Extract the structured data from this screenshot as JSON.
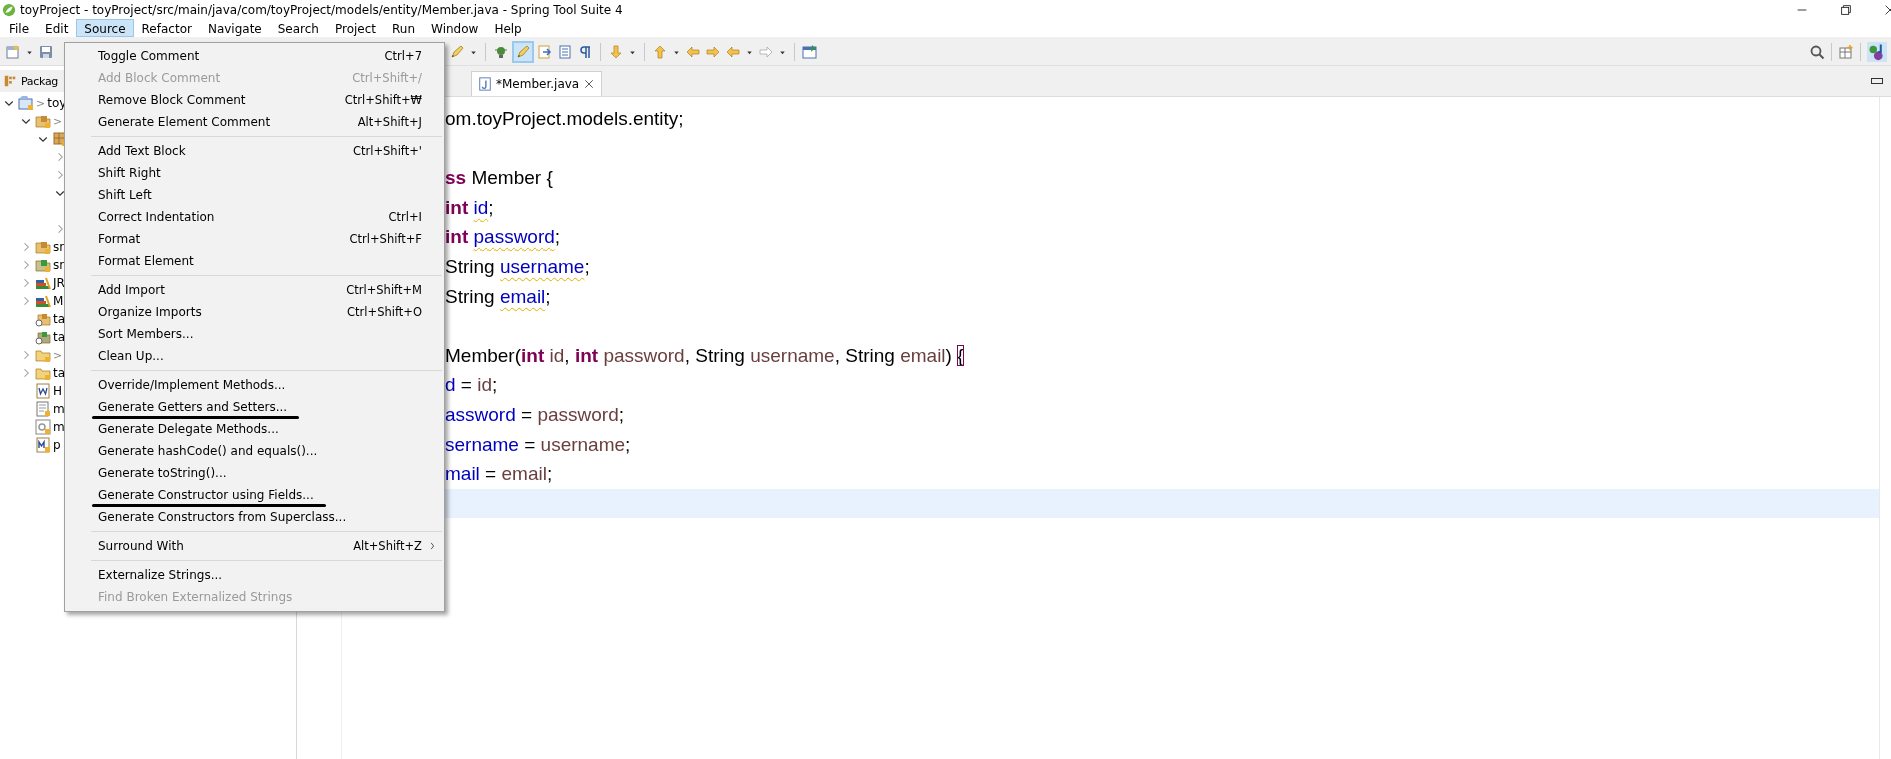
{
  "window": {
    "title": "toyProject - toyProject/src/main/java/com/toyProject/models/entity/Member.java - Spring Tool Suite 4"
  },
  "menubar": [
    {
      "label": "File",
      "selected": false
    },
    {
      "label": "Edit",
      "selected": false
    },
    {
      "label": "Source",
      "selected": true
    },
    {
      "label": "Refactor",
      "selected": false
    },
    {
      "label": "Navigate",
      "selected": false
    },
    {
      "label": "Search",
      "selected": false
    },
    {
      "label": "Project",
      "selected": false
    },
    {
      "label": "Run",
      "selected": false
    },
    {
      "label": "Window",
      "selected": false
    },
    {
      "label": "Help",
      "selected": false
    }
  ],
  "sidebar": {
    "title": "Packag",
    "tree": [
      {
        "kind": "project",
        "decorator": ">",
        "label": "toy",
        "expanded": true,
        "children": [
          {
            "kind": "source-folder",
            "decorator": ">",
            "expanded": true,
            "children": [
              {
                "kind": "package",
                "expanded": true,
                "children": [
                  {
                    "expanded": false
                  },
                  {
                    "expanded": false
                  },
                  {
                    "expanded": true
                  },
                  {
                    "expanded": false
                  }
                ]
              }
            ]
          },
          {
            "kind": "source-folder",
            "label": "sr",
            "expanded": false
          },
          {
            "kind": "source-folder-green",
            "label": "sr",
            "expanded": false
          },
          {
            "kind": "library",
            "label": "JR",
            "expanded": false
          },
          {
            "kind": "library",
            "label": "M",
            "expanded": false
          },
          {
            "kind": "source-folder-off",
            "label": "ta"
          },
          {
            "kind": "source-folder-off-green",
            "label": "ta"
          },
          {
            "kind": "folder",
            "decorator": ">",
            "expanded": false
          },
          {
            "kind": "folder",
            "label": "ta",
            "expanded": false
          },
          {
            "kind": "word-file",
            "label": "H"
          },
          {
            "kind": "text-file",
            "label": "m"
          },
          {
            "kind": "settings-file",
            "label": "m"
          },
          {
            "kind": "maven-file",
            "label": "p"
          }
        ]
      }
    ]
  },
  "editor": {
    "tab": {
      "label": "*Member.java",
      "selected": true
    },
    "lines": [
      {
        "current": false,
        "tokens": [
          {
            "text": "om.toyProject.models.entity;",
            "kind": "plain"
          }
        ]
      },
      {
        "current": false
      },
      {
        "current": false,
        "tokens": [
          {
            "text": "ss",
            "kind": "keyword"
          },
          {
            "text": " Member {",
            "kind": "plain"
          }
        ]
      },
      {
        "current": false,
        "tokens": [
          {
            "text": "int ",
            "kind": "keyword"
          },
          {
            "text": "id",
            "kind": "field",
            "warning": true
          },
          {
            "text": ";",
            "kind": "plain"
          }
        ]
      },
      {
        "current": false,
        "tokens": [
          {
            "text": "int ",
            "kind": "keyword"
          },
          {
            "text": "password",
            "kind": "field",
            "warning": true
          },
          {
            "text": ";",
            "kind": "plain"
          }
        ]
      },
      {
        "current": false,
        "tokens": [
          {
            "text": "String ",
            "kind": "plain"
          },
          {
            "text": "username",
            "kind": "field",
            "warning": true
          },
          {
            "text": ";",
            "kind": "plain"
          }
        ]
      },
      {
        "current": false,
        "tokens": [
          {
            "text": "String ",
            "kind": "plain"
          },
          {
            "text": "email",
            "kind": "field",
            "warning": true
          },
          {
            "text": ";",
            "kind": "plain"
          }
        ]
      },
      {
        "current": false
      },
      {
        "current": false,
        "tokens": [
          {
            "text": "Member(",
            "kind": "plain"
          },
          {
            "text": "int ",
            "kind": "keyword"
          },
          {
            "text": "id",
            "kind": "param"
          },
          {
            "text": ", ",
            "kind": "plain"
          },
          {
            "text": "int ",
            "kind": "keyword"
          },
          {
            "text": "password",
            "kind": "param"
          },
          {
            "text": ", String ",
            "kind": "plain"
          },
          {
            "text": "username",
            "kind": "param"
          },
          {
            "text": ", String ",
            "kind": "plain"
          },
          {
            "text": "email",
            "kind": "param"
          },
          {
            "text": ") ",
            "kind": "plain"
          },
          {
            "text": "{",
            "kind": "plain",
            "matched": true
          }
        ]
      },
      {
        "current": false,
        "tokens": [
          {
            "text": "d",
            "kind": "field"
          },
          {
            "text": " = ",
            "kind": "plain"
          },
          {
            "text": "id",
            "kind": "param"
          },
          {
            "text": ";",
            "kind": "plain"
          }
        ]
      },
      {
        "current": false,
        "tokens": [
          {
            "text": "assword",
            "kind": "field"
          },
          {
            "text": " = ",
            "kind": "plain"
          },
          {
            "text": "password",
            "kind": "param"
          },
          {
            "text": ";",
            "kind": "plain"
          }
        ]
      },
      {
        "current": false,
        "tokens": [
          {
            "text": "sername",
            "kind": "field"
          },
          {
            "text": " = ",
            "kind": "plain"
          },
          {
            "text": "username",
            "kind": "param"
          },
          {
            "text": ";",
            "kind": "plain"
          }
        ]
      },
      {
        "current": false,
        "tokens": [
          {
            "text": "mail",
            "kind": "field"
          },
          {
            "text": " = ",
            "kind": "plain"
          },
          {
            "text": "email",
            "kind": "param"
          },
          {
            "text": ";",
            "kind": "plain"
          }
        ]
      },
      {
        "current": true
      }
    ]
  },
  "menu": {
    "items": [
      {
        "kind": "item",
        "label": "Toggle Comment",
        "shortcut": "Ctrl+7",
        "disabled": false,
        "underlined": false
      },
      {
        "kind": "item",
        "label": "Add Block Comment",
        "shortcut": "Ctrl+Shift+/",
        "disabled": true,
        "underlined": false
      },
      {
        "kind": "item",
        "label": "Remove Block Comment",
        "shortcut": "Ctrl+Shift+₩",
        "disabled": false,
        "underlined": false
      },
      {
        "kind": "item",
        "label": "Generate Element Comment",
        "shortcut": "Alt+Shift+J",
        "disabled": false,
        "underlined": false
      },
      {
        "kind": "separator"
      },
      {
        "kind": "item",
        "label": "Add Text Block",
        "shortcut": "Ctrl+Shift+'",
        "disabled": false,
        "underlined": false
      },
      {
        "kind": "item",
        "label": "Shift Right",
        "disabled": false,
        "underlined": false
      },
      {
        "kind": "item",
        "label": "Shift Left",
        "disabled": false,
        "underlined": false
      },
      {
        "kind": "item",
        "label": "Correct Indentation",
        "shortcut": "Ctrl+I",
        "disabled": false,
        "underlined": false
      },
      {
        "kind": "item",
        "label": "Format",
        "shortcut": "Ctrl+Shift+F",
        "disabled": false,
        "underlined": false
      },
      {
        "kind": "item",
        "label": "Format Element",
        "disabled": false,
        "underlined": false
      },
      {
        "kind": "separator"
      },
      {
        "kind": "item",
        "label": "Add Import",
        "shortcut": "Ctrl+Shift+M",
        "disabled": false,
        "underlined": false
      },
      {
        "kind": "item",
        "label": "Organize Imports",
        "shortcut": "Ctrl+Shift+O",
        "disabled": false,
        "underlined": false
      },
      {
        "kind": "item",
        "label": "Sort Members...",
        "disabled": false,
        "underlined": false
      },
      {
        "kind": "item",
        "label": "Clean Up...",
        "disabled": false,
        "underlined": false
      },
      {
        "kind": "separator"
      },
      {
        "kind": "item",
        "label": "Override/Implement Methods...",
        "disabled": false,
        "underlined": false
      },
      {
        "kind": "item",
        "label": "Generate Getters and Setters...",
        "disabled": false,
        "underlined": true
      },
      {
        "kind": "item",
        "label": "Generate Delegate Methods...",
        "disabled": false,
        "underlined": false
      },
      {
        "kind": "item",
        "label": "Generate hashCode() and equals()...",
        "disabled": false,
        "underlined": false
      },
      {
        "kind": "item",
        "label": "Generate toString()...",
        "disabled": false,
        "underlined": false
      },
      {
        "kind": "item",
        "label": "Generate Constructor using Fields...",
        "disabled": false,
        "underlined": true
      },
      {
        "kind": "item",
        "label": "Generate Constructors from Superclass...",
        "disabled": false,
        "underlined": false
      },
      {
        "kind": "separator"
      },
      {
        "kind": "item",
        "label": "Surround With",
        "shortcut": "Alt+Shift+Z",
        "submenu": true,
        "disabled": false,
        "underlined": false
      },
      {
        "kind": "separator"
      },
      {
        "kind": "item",
        "label": "Externalize Strings...",
        "disabled": false,
        "underlined": false
      },
      {
        "kind": "item",
        "label": "Find Broken Externalized Strings",
        "disabled": true,
        "underlined": false
      }
    ]
  }
}
